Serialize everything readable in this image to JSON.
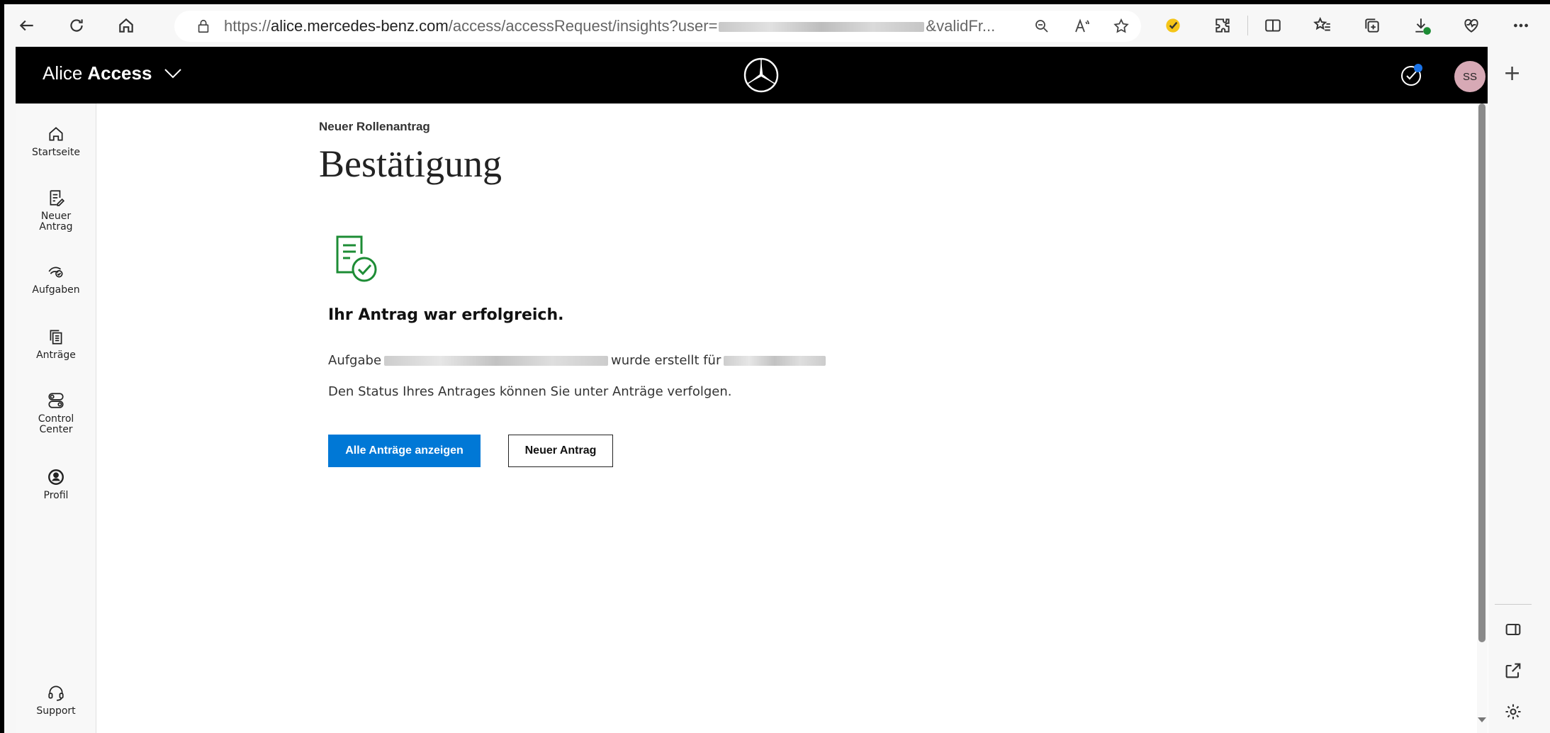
{
  "browser": {
    "url_prefix": "https://",
    "url_host": "alice.mercedes-benz.com",
    "url_path": "/access/accessRequest/insights?user=",
    "url_suffix": "&validFr..."
  },
  "header": {
    "brand_light": "Alice",
    "brand_bold": "Access",
    "avatar_initials": "SS"
  },
  "sidebar": {
    "items": [
      {
        "label": "Startseite",
        "icon": "home-icon"
      },
      {
        "label": "Neuer Antrag",
        "icon": "new-request-icon"
      },
      {
        "label": "Aufgaben",
        "icon": "tasks-icon"
      },
      {
        "label": "Anträge",
        "icon": "requests-icon"
      },
      {
        "label": "Control Center",
        "icon": "toggle-icon"
      },
      {
        "label": "Profil",
        "icon": "profile-icon"
      },
      {
        "label": "Support",
        "icon": "headset-icon"
      }
    ]
  },
  "main": {
    "eyebrow": "Neuer Rollenantrag",
    "title": "Bestätigung",
    "success_heading": "Ihr Antrag war erfolgreich.",
    "line1_prefix": "Aufgabe",
    "line1_middle": "wurde erstellt für",
    "line2": "Den Status Ihres Antrages können Sie unter Anträge verfolgen.",
    "primary_button": "Alle Anträge anzeigen",
    "secondary_button": "Neuer Antrag"
  },
  "edge_side": {
    "add_label": "+"
  },
  "colors": {
    "primary": "#0078d6",
    "success": "#1d8c35",
    "header_bg": "#000000",
    "avatar_bg": "#d7a9b5",
    "notification": "#1a73e8"
  }
}
